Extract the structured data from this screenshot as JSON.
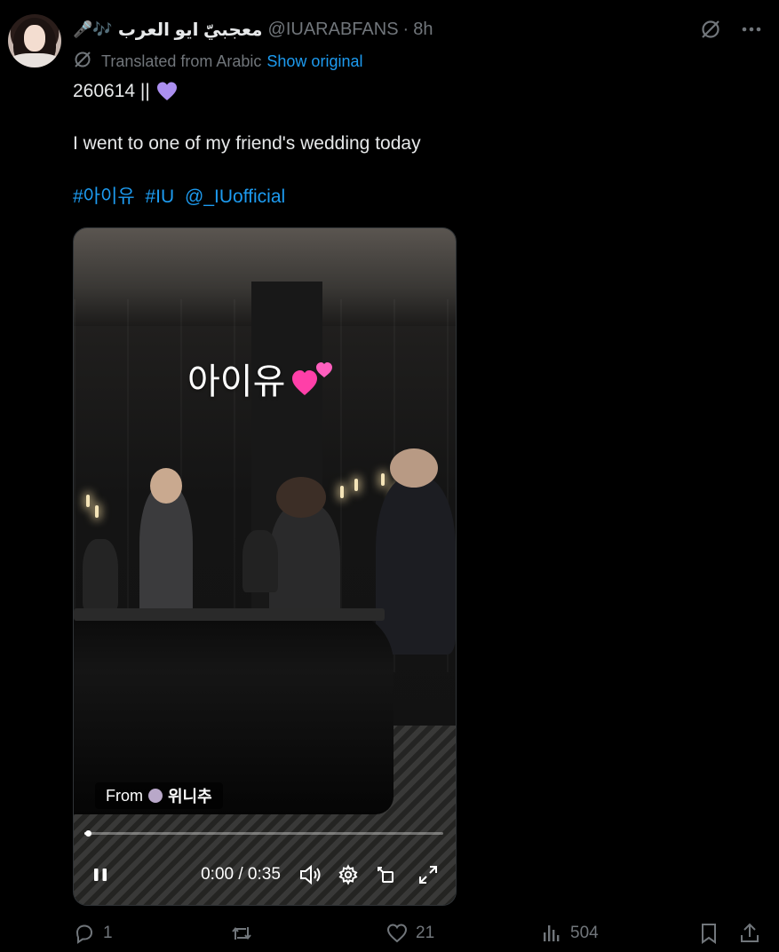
{
  "post": {
    "display_name": "معجبيّ ايو العرب",
    "name_emoji": "🎤🎶",
    "handle": "@IUARABFANS",
    "separator": "·",
    "time": "8h",
    "translated_label": "Translated from Arabic",
    "show_original": "Show original",
    "text_line1": "260614 ||",
    "text_line2": "I went to one of my friend's wedding today",
    "hashtags": [
      "#아이유",
      "#IU",
      "@_IUofficial"
    ]
  },
  "video": {
    "overlay_text": "아이유",
    "from_label": "From",
    "source_name": "위니추",
    "time_current": "0:00",
    "time_total": "0:35",
    "time_display": "0:00 / 0:35",
    "progress": 0.01
  },
  "actions": {
    "replies": "1",
    "reposts": "",
    "likes": "21",
    "views": "504"
  },
  "colors": {
    "background": "#000000",
    "text": "#e7e9ea",
    "muted": "#71767b",
    "link": "#1d9bf0",
    "heart_emoji": "#ab8ff0",
    "hearts_overlay": "#ff3fa8"
  },
  "icons": {
    "grok": "grok-icon",
    "more": "more-icon",
    "translate": "translate-icon",
    "reply": "reply-icon",
    "repost": "repost-icon",
    "like": "like-icon",
    "views": "views-icon",
    "bookmark": "bookmark-icon",
    "share": "share-icon",
    "pause": "pause-icon",
    "volume": "volume-icon",
    "settings": "settings-icon",
    "pip": "picture-in-picture-icon",
    "fullscreen": "fullscreen-icon"
  }
}
